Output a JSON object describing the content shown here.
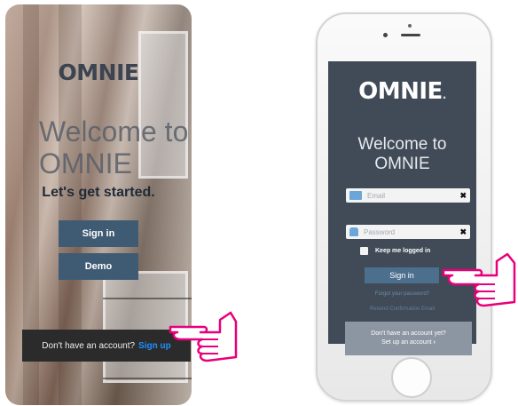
{
  "left": {
    "brand": "OMNIE",
    "welcome": "Welcome to OMNIE",
    "tagline": "Let's get started.",
    "signin_label": "Sign in",
    "demo_label": "Demo",
    "no_account_text": "Don't have an account?",
    "signup_label": "Sign up"
  },
  "phone": {
    "brand": "OMNIE",
    "brand_dot": ".",
    "welcome": "Welcome to OMNIE",
    "email_placeholder": "Email",
    "password_placeholder": "Password",
    "clear_glyph": "✖",
    "remember_label": "Keep me logged in",
    "signin_label": "Sign in",
    "forgot_label": "Forgot your password?",
    "resend_label": "Resend Confirmation Email",
    "no_account_text": "Don't have an account yet?",
    "setup_label": "Set up an account",
    "setup_arrow": "›"
  },
  "colors": {
    "left_button": "#3f5a73",
    "left_signup_link": "#1e90ff",
    "phone_screen": "#414b57",
    "phone_signin_button": "#4c6f8e",
    "hand_outline": "#e8007a",
    "email_icon": "#6aa6d8",
    "password_icon": "#6aa6d8"
  },
  "icons": {
    "email": "envelope-icon",
    "password": "lock-icon",
    "pointer": "pointing-hand-icon"
  }
}
